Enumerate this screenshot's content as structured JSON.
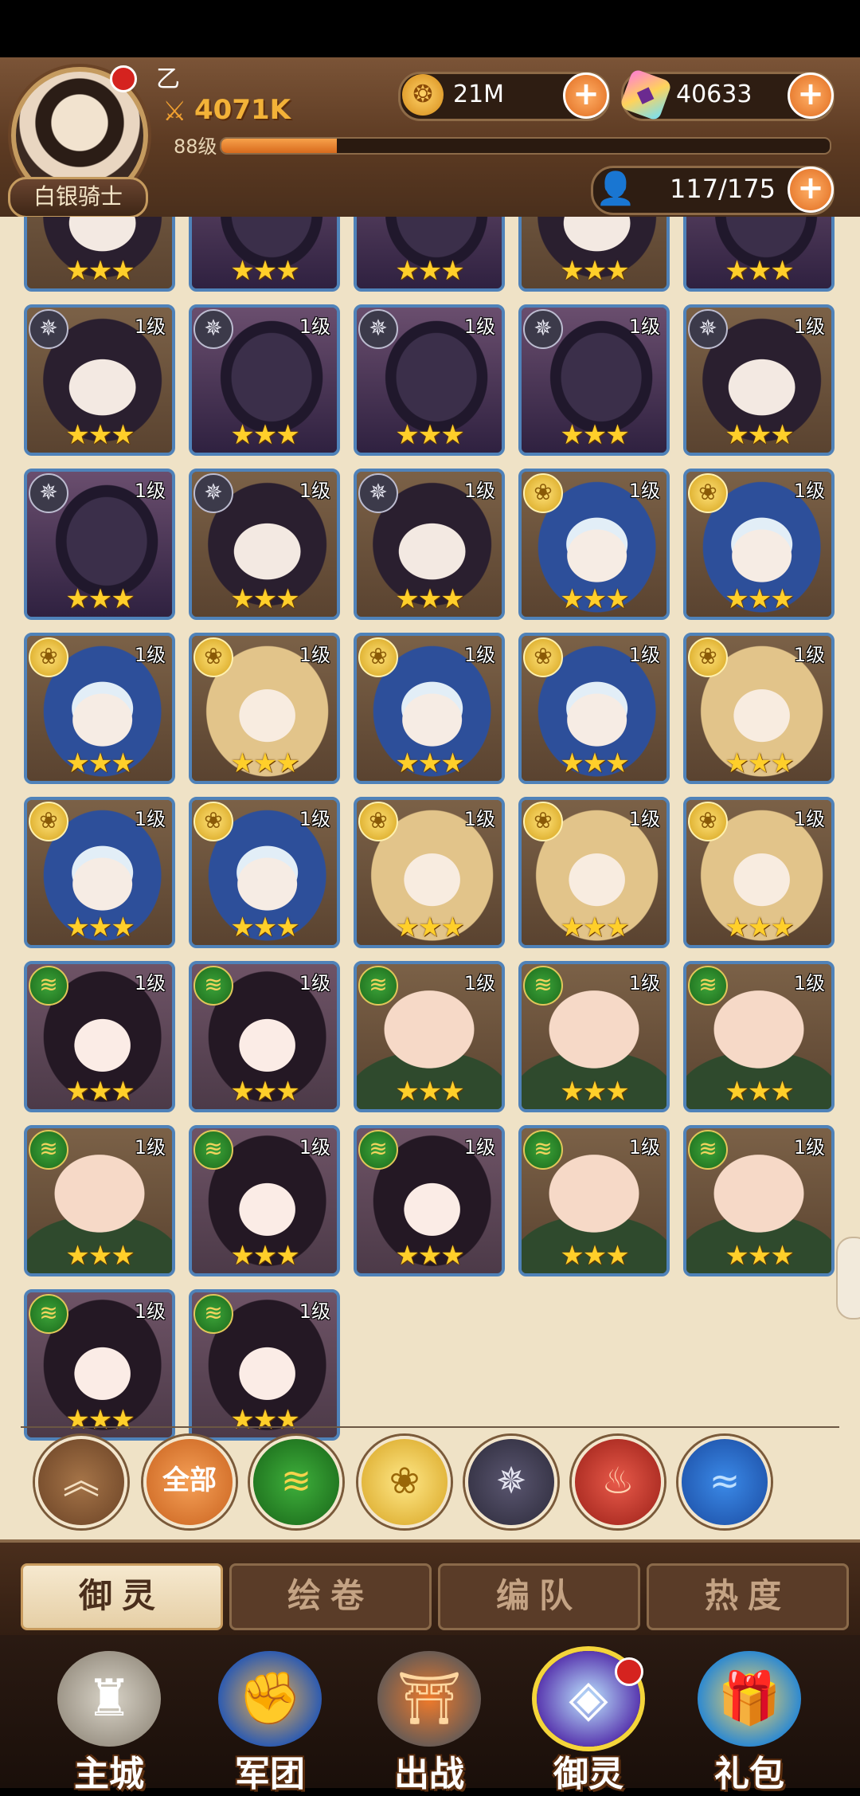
{
  "header": {
    "player_name": "乙",
    "rank": "白银骑士",
    "power": "4071K",
    "level": "88级",
    "xp_progress": 0.19,
    "gold": "21M",
    "gems": "40633",
    "population": "117/175"
  },
  "cards": [
    {
      "element": "dark",
      "portrait": "witch",
      "level": "1级",
      "stars": "★★★"
    },
    {
      "element": "dark",
      "portrait": "knight",
      "level": "1级",
      "stars": "★★★"
    },
    {
      "element": "dark",
      "portrait": "knight",
      "level": "1级",
      "stars": "★★★"
    },
    {
      "element": "dark",
      "portrait": "knight",
      "level": "1级",
      "stars": "★★★"
    },
    {
      "element": "dark",
      "portrait": "witch",
      "level": "1级",
      "stars": "★★★"
    },
    {
      "element": "dark",
      "portrait": "knight",
      "level": "1级",
      "stars": "★★★"
    },
    {
      "element": "dark",
      "portrait": "witch",
      "level": "1级",
      "stars": "★★★"
    },
    {
      "element": "dark",
      "portrait": "witch",
      "level": "1级",
      "stars": "★★★"
    },
    {
      "element": "gold",
      "portrait": "hood",
      "level": "1级",
      "stars": "★★★"
    },
    {
      "element": "gold",
      "portrait": "hood",
      "level": "1级",
      "stars": "★★★"
    },
    {
      "element": "gold",
      "portrait": "hood",
      "level": "1级",
      "stars": "★★★"
    },
    {
      "element": "gold",
      "portrait": "blonde",
      "level": "1级",
      "stars": "★★★"
    },
    {
      "element": "gold",
      "portrait": "hood",
      "level": "1级",
      "stars": "★★★"
    },
    {
      "element": "gold",
      "portrait": "hood",
      "level": "1级",
      "stars": "★★★"
    },
    {
      "element": "gold",
      "portrait": "blonde",
      "level": "1级",
      "stars": "★★★"
    },
    {
      "element": "gold",
      "portrait": "hood",
      "level": "1级",
      "stars": "★★★"
    },
    {
      "element": "gold",
      "portrait": "hood",
      "level": "1级",
      "stars": "★★★"
    },
    {
      "element": "gold",
      "portrait": "blonde",
      "level": "1级",
      "stars": "★★★"
    },
    {
      "element": "gold",
      "portrait": "blonde",
      "level": "1级",
      "stars": "★★★"
    },
    {
      "element": "gold",
      "portrait": "blonde",
      "level": "1级",
      "stars": "★★★"
    },
    {
      "element": "wind",
      "portrait": "girl",
      "level": "1级",
      "stars": "★★★"
    },
    {
      "element": "wind",
      "portrait": "girl",
      "level": "1级",
      "stars": "★★★"
    },
    {
      "element": "wind",
      "portrait": "monk",
      "level": "1级",
      "stars": "★★★"
    },
    {
      "element": "wind",
      "portrait": "monk",
      "level": "1级",
      "stars": "★★★"
    },
    {
      "element": "wind",
      "portrait": "monk",
      "level": "1级",
      "stars": "★★★"
    },
    {
      "element": "wind",
      "portrait": "monk",
      "level": "1级",
      "stars": "★★★"
    },
    {
      "element": "wind",
      "portrait": "girl",
      "level": "1级",
      "stars": "★★★"
    },
    {
      "element": "wind",
      "portrait": "girl",
      "level": "1级",
      "stars": "★★★"
    },
    {
      "element": "wind",
      "portrait": "monk",
      "level": "1级",
      "stars": "★★★"
    },
    {
      "element": "wind",
      "portrait": "monk",
      "level": "1级",
      "stars": "★★★"
    },
    {
      "element": "wind",
      "portrait": "girl",
      "level": "1级",
      "stars": "★★★"
    },
    {
      "element": "wind",
      "portrait": "girl",
      "level": "1级",
      "stars": "★★★"
    }
  ],
  "partial_row": [
    {
      "portrait": "witch",
      "stars": "★★★"
    },
    {
      "portrait": "knight",
      "stars": "★★★"
    },
    {
      "portrait": "knight",
      "stars": "★★★"
    },
    {
      "portrait": "witch",
      "stars": "★★★"
    },
    {
      "portrait": "knight",
      "stars": "★★★"
    }
  ],
  "filters": {
    "collapse_icon": "double-chevron-up-icon",
    "all_label": "全部",
    "wind_icon": "wind-element-icon",
    "gold_icon": "rose-element-icon",
    "dark_icon": "star-web-element-icon",
    "fire_icon": "phoenix-element-icon",
    "water_icon": "wave-element-icon"
  },
  "tabs": [
    "御灵",
    "绘卷",
    "编队",
    "热度"
  ],
  "active_tab": 0,
  "nav": [
    "主城",
    "军团",
    "出战",
    "御灵",
    "礼包"
  ],
  "active_nav": 3,
  "colors": {
    "card_border": "#4f82b9",
    "accent": "#e06b1f",
    "star": "#ffcf2a"
  }
}
